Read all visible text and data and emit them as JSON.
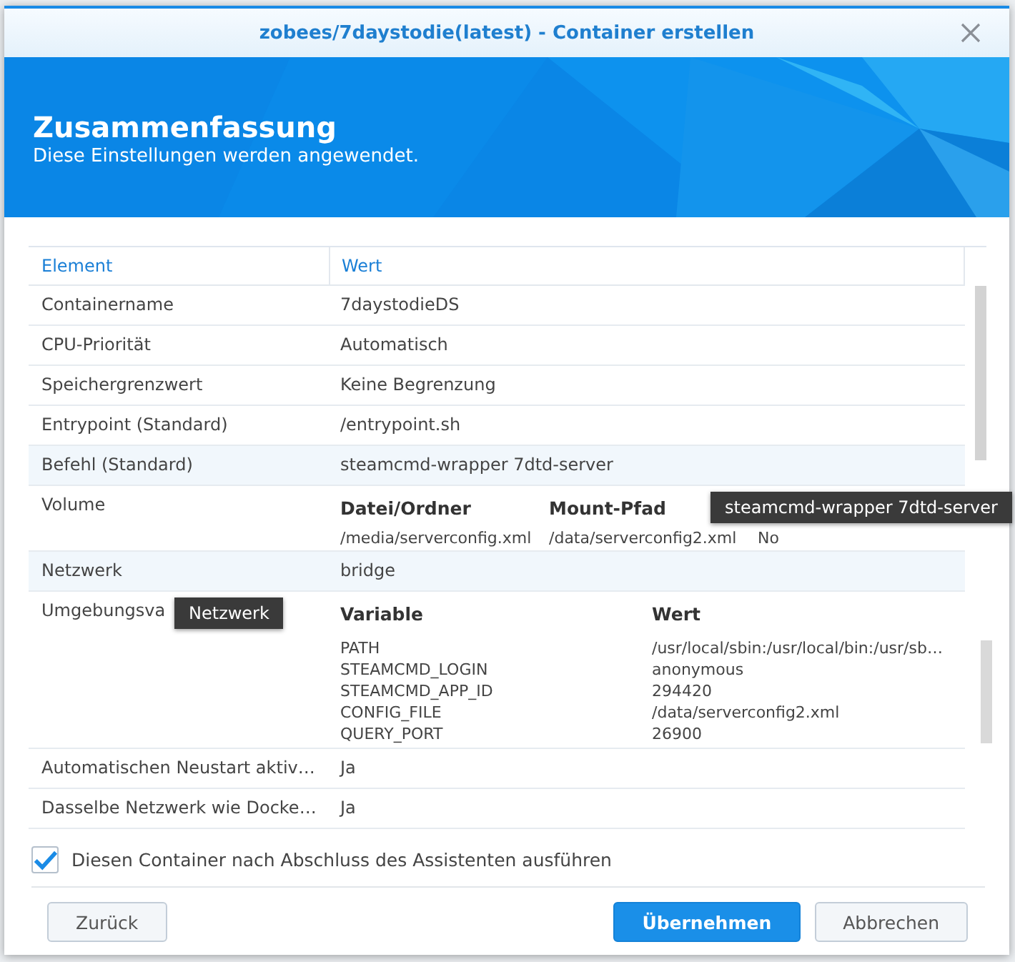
{
  "window": {
    "title": "zobees/7daystodie(latest) - Container erstellen"
  },
  "banner": {
    "title": "Zusammenfassung",
    "subtitle": "Diese Einstellungen werden angewendet."
  },
  "table": {
    "columns": [
      "Element",
      "Wert"
    ],
    "rows": [
      {
        "kind": "text",
        "label": "Containername",
        "value": "7daystodieDS",
        "hovered": false
      },
      {
        "kind": "text",
        "label": "CPU-Priorität",
        "value": "Automatisch",
        "hovered": false
      },
      {
        "kind": "text",
        "label": "Speichergrenzwert",
        "value": "Keine Begrenzung",
        "hovered": false
      },
      {
        "kind": "text",
        "label": "Entrypoint (Standard)",
        "value": "/entrypoint.sh",
        "hovered": false
      },
      {
        "kind": "text",
        "label": "Befehl (Standard)",
        "value": "steamcmd-wrapper 7dtd-server",
        "hovered": true,
        "tooltip": "steamcmd-wrapper 7dtd-server"
      },
      {
        "kind": "volume",
        "label": "Volume",
        "hovered": false,
        "headers": [
          "Datei/Ordner",
          "Mount-Pfad"
        ],
        "rows": [
          [
            "/media/serverconfig.xml",
            "/data/serverconfig2.xml",
            "No"
          ]
        ]
      },
      {
        "kind": "text",
        "label": "Netzwerk",
        "value": "bridge",
        "hovered": true,
        "tooltip": "Netzwerk"
      },
      {
        "kind": "env",
        "label": "Umgebungsva",
        "hovered": false,
        "headers": [
          "Variable",
          "Wert"
        ],
        "rows": [
          [
            "PATH",
            "/usr/local/sbin:/usr/local/bin:/usr/sb…"
          ],
          [
            "STEAMCMD_LOGIN",
            "anonymous"
          ],
          [
            "STEAMCMD_APP_ID",
            "294420"
          ],
          [
            "CONFIG_FILE",
            "/data/serverconfig2.xml"
          ],
          [
            "QUERY_PORT",
            "26900"
          ]
        ]
      },
      {
        "kind": "text",
        "label": "Automatischen Neustart aktiv…",
        "value": "Ja",
        "hovered": false
      },
      {
        "kind": "text",
        "label": "Dasselbe Netzwerk wie Docke…",
        "value": "Ja",
        "hovered": false
      }
    ]
  },
  "run_after": {
    "label": "Diesen Container nach Abschluss des Assistenten ausführen",
    "checked": true
  },
  "buttons": [
    {
      "label": "Zurück",
      "kind": "back"
    },
    {
      "label": "Übernehmen",
      "kind": "primary"
    },
    {
      "label": "Abbrechen",
      "kind": "default"
    }
  ]
}
